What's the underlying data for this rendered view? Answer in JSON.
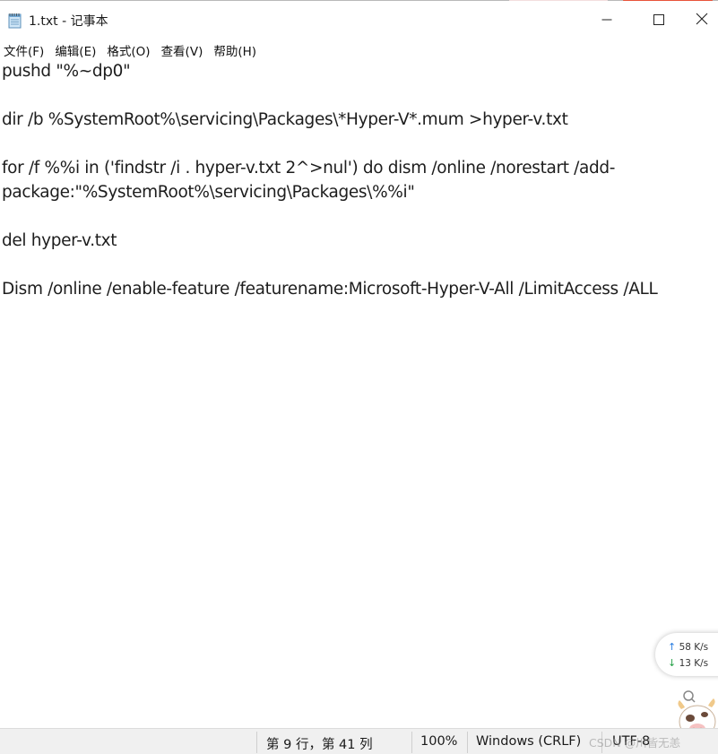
{
  "window": {
    "title": "1.txt - 记事本",
    "app_icon": "notepad-icon",
    "controls": {
      "minimize": "minimize-icon",
      "maximize": "maximize-icon",
      "close": "close-icon"
    }
  },
  "menu": {
    "items": [
      {
        "label": "文件(F)"
      },
      {
        "label": "编辑(E)"
      },
      {
        "label": "格式(O)"
      },
      {
        "label": "查看(V)"
      },
      {
        "label": "帮助(H)"
      }
    ]
  },
  "editor": {
    "lines": [
      "pushd \"%~dp0\"",
      "",
      "dir /b %SystemRoot%\\servicing\\Packages\\*Hyper-V*.mum >hyper-v.txt",
      "",
      "for /f %%i in ('findstr /i . hyper-v.txt 2^>nul') do dism /online /norestart /add-",
      "package:\"%SystemRoot%\\servicing\\Packages\\%%i\"",
      "",
      "del hyper-v.txt",
      "",
      "Dism /online /enable-feature /featurename:Microsoft-Hyper-V-All /LimitAccess /ALL"
    ]
  },
  "statusbar": {
    "position": "第 9 行，第 41 列",
    "zoom": "100%",
    "line_ending": "Windows (CRLF)",
    "encoding": "UTF-8"
  },
  "network_widget": {
    "upload": "58  K/s",
    "download": "13  K/s",
    "upload_color": "#2a7de1",
    "download_color": "#22a045"
  },
  "watermark": {
    "text": "CSDN @川皆无恙"
  }
}
